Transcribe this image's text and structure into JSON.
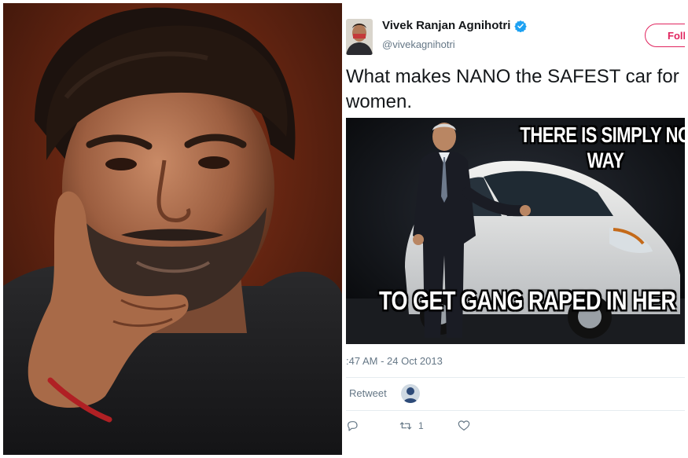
{
  "tweet": {
    "display_name": "Vivek Ranjan Agnihotri",
    "handle": "@vivekagnihotri",
    "follow_label": "Follow",
    "text": "What makes NANO the SAFEST car for women.",
    "meme": {
      "caption_top": "THERE IS SIMPLY NO WAY",
      "caption_bottom": "TO GET GANG RAPED IN HER"
    },
    "timestamp": ":47 AM - 24 Oct 2013",
    "retweet_label": "Retweet",
    "actions": {
      "retweet_count": "1"
    }
  },
  "colors": {
    "follow_accent": "#e0245e",
    "verified_blue": "#1da1f2",
    "muted_text": "#657786",
    "portrait_bg": "#6e2412",
    "meme_bg": "#0d0f12"
  },
  "icons": [
    "verified-badge-icon",
    "reply-icon",
    "retweet-icon",
    "like-heart-icon"
  ]
}
